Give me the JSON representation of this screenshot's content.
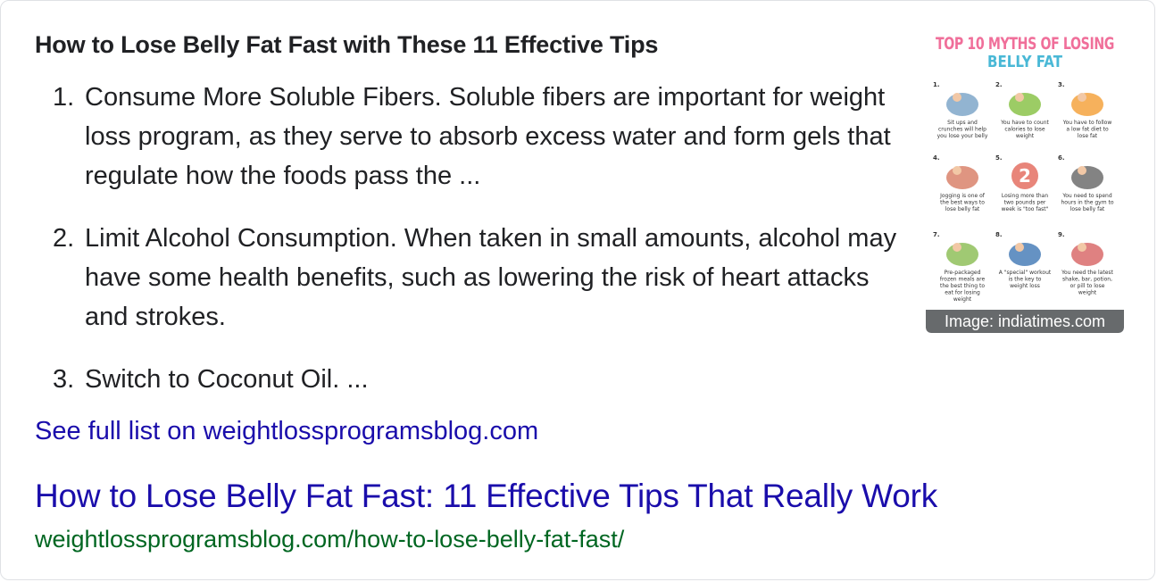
{
  "heading": "How to Lose Belly Fat Fast with These 11 Effective Tips",
  "tips": [
    {
      "num": "1.",
      "text": "Consume More Soluble Fibers. Soluble fibers are important for weight loss program, as they serve to absorb excess water and form gels that regulate how the foods pass the ..."
    },
    {
      "num": "2.",
      "text": "Limit Alcohol Consumption. When taken in small amounts, alcohol may have some health benefits, such as lowering the risk of heart attacks and strokes."
    },
    {
      "num": "3.",
      "text": "Switch to Coconut Oil. ..."
    }
  ],
  "see_full": "See full list on weightlossprogramsblog.com",
  "result": {
    "title": "How to Lose Belly Fat Fast: 11 Effective Tips That Really Work",
    "url": "weightlossprogramsblog.com/how-to-lose-belly-fat-fast/"
  },
  "thumbnail": {
    "caption": "Image: indiatimes.com",
    "infographic_title_1": "TOP 10 MYTHS OF LOSING",
    "infographic_title_2": "BELLY FAT",
    "big_number": "2",
    "cells": [
      {
        "num": "1.",
        "lines": [
          "Sit ups and",
          "crunches will help",
          "you lose your belly"
        ]
      },
      {
        "num": "2.",
        "lines": [
          "You have to count",
          "calories to lose",
          "weight"
        ]
      },
      {
        "num": "3.",
        "lines": [
          "You have to follow",
          "a low fat diet to",
          "lose fat"
        ]
      },
      {
        "num": "4.",
        "lines": [
          "Jogging is one of",
          "the best ways to",
          "lose belly fat"
        ]
      },
      {
        "num": "5.",
        "lines": [
          "Losing more than",
          "two pounds per",
          "week is \"too fast\""
        ]
      },
      {
        "num": "6.",
        "lines": [
          "You need to spend",
          "hours in the gym to",
          "lose belly fat"
        ]
      },
      {
        "num": "7.",
        "lines": [
          "Pre-packaged",
          "frozen meals are",
          "the best thing to",
          "eat for losing",
          "weight"
        ]
      },
      {
        "num": "8.",
        "lines": [
          "A \"special\" workout",
          "is the key to",
          "weight loss"
        ]
      },
      {
        "num": "9.",
        "lines": [
          "You need the latest",
          "shake, bar, potion,",
          "or pill to lose",
          "weight"
        ]
      }
    ],
    "colors": {
      "title_pink": "#f06f9a",
      "title_cyan": "#49b8d6",
      "badge": "#e8857a"
    }
  }
}
